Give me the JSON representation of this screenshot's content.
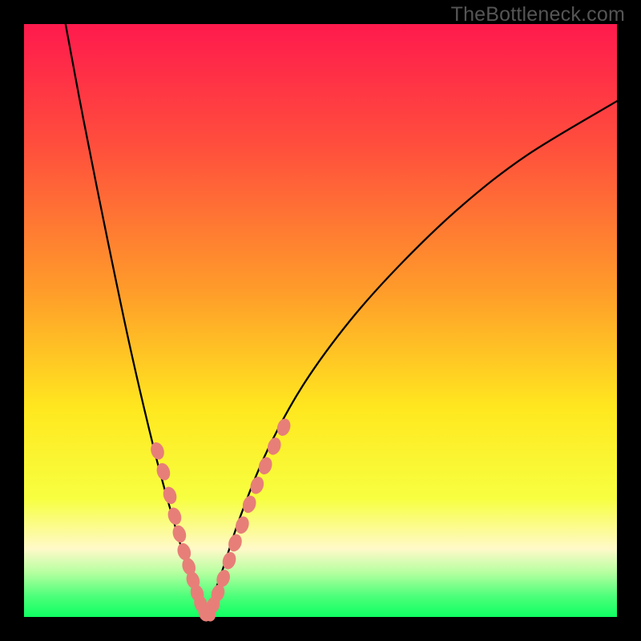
{
  "watermark": "TheBottleneck.com",
  "colors": {
    "curve": "#000000",
    "dots": "#e77f78",
    "background_frame": "#000000"
  },
  "chart_data": {
    "type": "line",
    "title": "",
    "xlabel": "",
    "ylabel": "",
    "xlim": [
      0,
      100
    ],
    "ylim_pct_from_top": [
      0,
      100
    ],
    "note": "Decorative bottleneck V-curve over red→green vertical heat gradient. The curve plunges near x≈30.5 to the bottom (best match) and rises on both sides. Pink dots mark the near-bottom segments on each arm. Values are normalized to the 740×740 plot area (0=left/top, 100=right/bottom).",
    "series": [
      {
        "name": "bottleneck-curve",
        "points": [
          {
            "x": 7.0,
            "y": 0.0
          },
          {
            "x": 10.0,
            "y": 16.0
          },
          {
            "x": 14.0,
            "y": 36.0
          },
          {
            "x": 18.0,
            "y": 55.0
          },
          {
            "x": 22.0,
            "y": 72.0
          },
          {
            "x": 25.0,
            "y": 83.0
          },
          {
            "x": 27.5,
            "y": 91.5
          },
          {
            "x": 29.5,
            "y": 97.5
          },
          {
            "x": 30.5,
            "y": 99.5
          },
          {
            "x": 31.5,
            "y": 97.5
          },
          {
            "x": 33.5,
            "y": 92.0
          },
          {
            "x": 36.5,
            "y": 83.0
          },
          {
            "x": 41.0,
            "y": 72.0
          },
          {
            "x": 47.0,
            "y": 61.0
          },
          {
            "x": 55.0,
            "y": 50.0
          },
          {
            "x": 64.0,
            "y": 40.0
          },
          {
            "x": 74.0,
            "y": 30.5
          },
          {
            "x": 85.0,
            "y": 22.0
          },
          {
            "x": 100.0,
            "y": 13.0
          }
        ]
      }
    ],
    "dots_left_arm": [
      {
        "x": 22.5,
        "y": 72.0
      },
      {
        "x": 23.5,
        "y": 75.5
      },
      {
        "x": 24.6,
        "y": 79.5
      },
      {
        "x": 25.4,
        "y": 83.0
      },
      {
        "x": 26.2,
        "y": 86.0
      },
      {
        "x": 27.0,
        "y": 89.0
      },
      {
        "x": 27.8,
        "y": 91.5
      },
      {
        "x": 28.5,
        "y": 93.8
      },
      {
        "x": 29.2,
        "y": 96.0
      },
      {
        "x": 29.8,
        "y": 97.8
      },
      {
        "x": 30.5,
        "y": 99.3
      },
      {
        "x": 31.2,
        "y": 99.3
      }
    ],
    "dots_right_arm": [
      {
        "x": 31.9,
        "y": 98.0
      },
      {
        "x": 32.7,
        "y": 96.0
      },
      {
        "x": 33.6,
        "y": 93.5
      },
      {
        "x": 34.6,
        "y": 90.5
      },
      {
        "x": 35.6,
        "y": 87.5
      },
      {
        "x": 36.8,
        "y": 84.5
      },
      {
        "x": 38.0,
        "y": 81.0
      },
      {
        "x": 39.3,
        "y": 77.8
      },
      {
        "x": 40.7,
        "y": 74.5
      },
      {
        "x": 42.2,
        "y": 71.2
      },
      {
        "x": 43.8,
        "y": 68.0
      }
    ]
  }
}
